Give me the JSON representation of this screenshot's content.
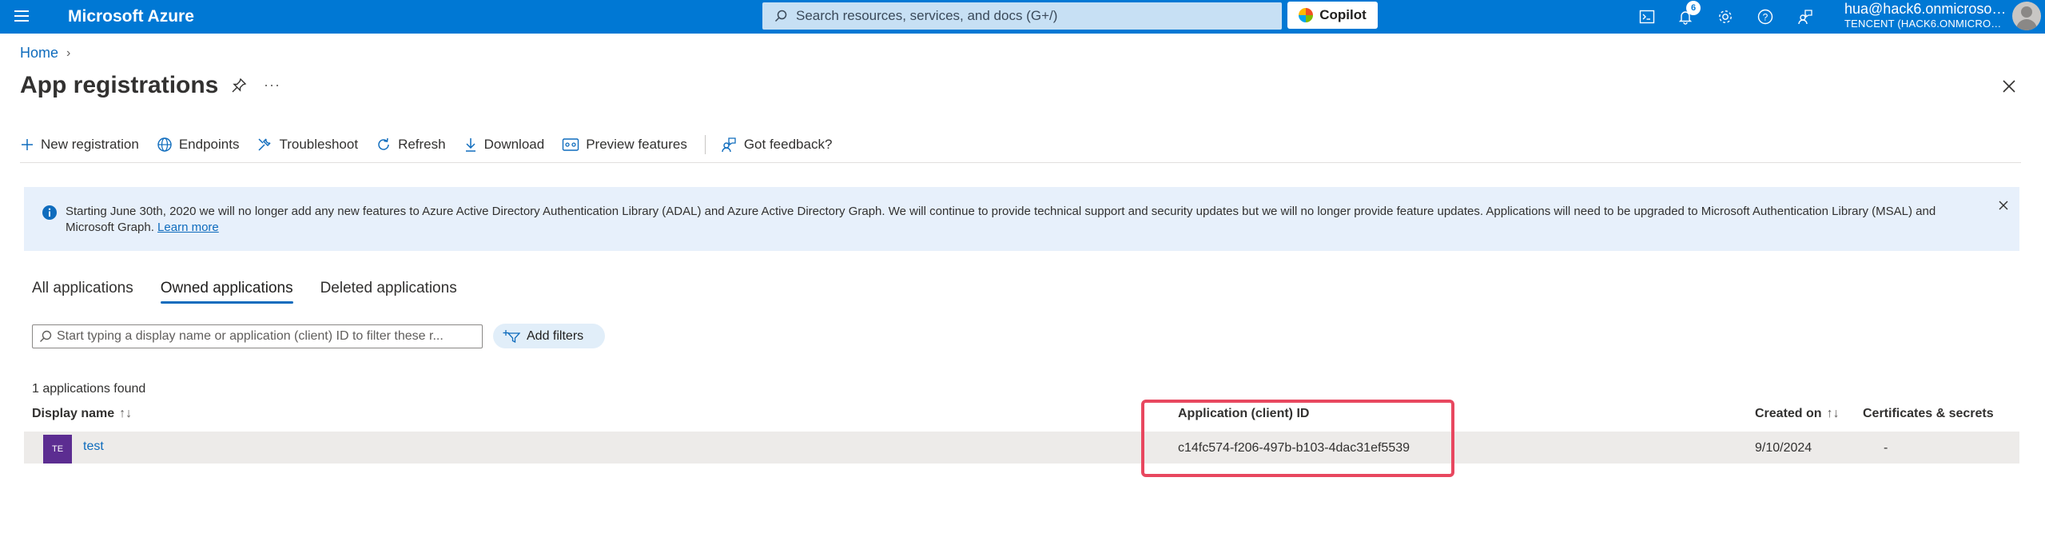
{
  "topbar": {
    "brand": "Microsoft Azure",
    "search_placeholder": "Search resources, services, and docs (G+/)",
    "copilot_label": "Copilot",
    "notification_count": "6",
    "user": "hua@hack6.onmicrosoft...",
    "tenant": "TENCENT (HACK6.ONMICROSO..."
  },
  "breadcrumb": {
    "home": "Home",
    "separator": "›"
  },
  "page": {
    "title": "App registrations",
    "more": "···"
  },
  "commands": [
    {
      "label": "New registration",
      "icon": "plus-icon"
    },
    {
      "label": "Endpoints",
      "icon": "globe-icon"
    },
    {
      "label": "Troubleshoot",
      "icon": "wrench-icon"
    },
    {
      "label": "Refresh",
      "icon": "refresh-icon"
    },
    {
      "label": "Download",
      "icon": "download-icon"
    },
    {
      "label": "Preview features",
      "icon": "preview-icon"
    },
    {
      "label": "Got feedback?",
      "icon": "feedback-icon"
    }
  ],
  "banner": {
    "text": "Starting June 30th, 2020 we will no longer add any new features to Azure Active Directory Authentication Library (ADAL) and Azure Active Directory Graph. We will continue to provide technical support and security updates but we will no longer provide feature updates. Applications will need to be upgraded to Microsoft Authentication Library (MSAL) and Microsoft Graph.",
    "link": "Learn more"
  },
  "tabs": [
    "All applications",
    "Owned applications",
    "Deleted applications"
  ],
  "filter": {
    "placeholder": "Start typing a display name or application (client) ID to filter these r...",
    "add_filters": "Add filters"
  },
  "results": {
    "count_text": "1 applications found",
    "columns": {
      "display_name": "Display name",
      "client_id": "Application (client) ID",
      "created_on": "Created on",
      "certs": "Certificates & secrets"
    },
    "sort_glyph": "↑↓",
    "rows": [
      {
        "initials": "TE",
        "name": "test",
        "client_id": "c14fc574-f206-497b-b103-4dac31ef5539",
        "created_on": "9/10/2024",
        "certs": "-"
      }
    ]
  },
  "colors": {
    "topbar": "#0078d4",
    "link": "#0f6cbd",
    "highlight": "#e8475f",
    "app_avatar": "#5c2d91"
  }
}
